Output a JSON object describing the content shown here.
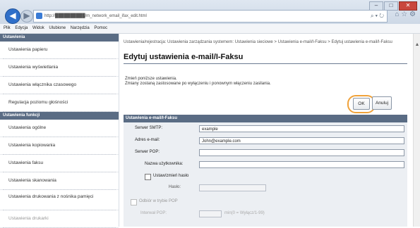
{
  "browser": {
    "address": "http://██████████/m_network_email_ifax_edit.html",
    "search_icon": "⌕ ▾ ↻",
    "tab_icons": "⌂ ☆ ⚙"
  },
  "menu": [
    "Plik",
    "Edycja",
    "Widok",
    "Ulubione",
    "Narzędzia",
    "Pomoc"
  ],
  "sidebar": {
    "sections": [
      {
        "title": "Ustawienia",
        "items": [
          "Ustawienia papieru",
          "Ustawienia wyświetlania",
          "Ustawienia włącznika czasowego",
          "Regulacja poziomu głośności"
        ]
      },
      {
        "title": "Ustawienia funkcji",
        "items": [
          "Ustawienia ogólne",
          "Ustawienia kopiowania",
          "Ustawienia faksu",
          "Ustawienia skanowania",
          "Ustawienia drukowania z nośnika pamięci",
          "Ustawienia drukarki"
        ]
      }
    ]
  },
  "main": {
    "breadcrumb": "Ustawienia/rejestracja: Ustawienia zarządzania systemem: Ustawienia sieciowe > Ustawienia e-mail/I-Faksu > Edytuj ustawienia e-mail/I-Faksu",
    "title": "Edytuj ustawienia e-mail/I-Faksu",
    "note_line1": "Zmień poniższe ustawienia.",
    "note_line2": "Zmiany zostaną zastosowane po wyłączeniu i ponownym włączeniu zasilania.",
    "ok_label": "OK",
    "cancel_label": "Anuluj",
    "panel_title": "Ustawienia e-mail/I-Faksu",
    "fields": {
      "smtp_label": "Serwer SMTP:",
      "smtp_value": "example",
      "email_label": "Adres e-mail:",
      "email_value": "John@example.com",
      "pop_label": "Serwer POP:",
      "pop_value": "",
      "user_label": "Nazwa użytkownika:",
      "user_value": "",
      "setpw_label": "Ustaw/zmień hasło",
      "pw_label": "Hasło:",
      "pw_value": "",
      "receive_label": "Odbiór w trybie POP",
      "interval_label": "Interwał POP:",
      "interval_hint": "min(0 = Wyłącz/1-99)"
    }
  },
  "colors": {
    "section_header": "#5a6c84",
    "ok_highlight": "#f0a23a"
  }
}
